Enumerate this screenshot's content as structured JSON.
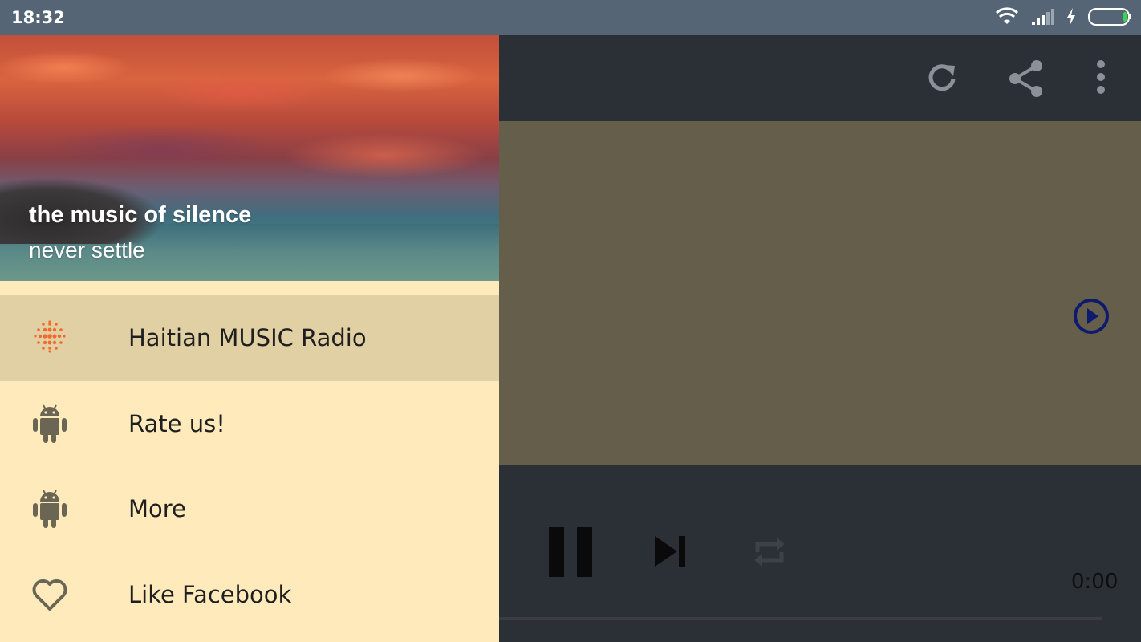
{
  "status_bar": {
    "time": "18:32",
    "icons": [
      "wifi-icon",
      "signal-icon",
      "charging-icon",
      "battery-icon"
    ]
  },
  "drawer": {
    "title": "the music of silence",
    "subtitle": "never settle",
    "items": [
      {
        "label": "Haitian MUSIC Radio",
        "icon": "radio-icon",
        "selected": true
      },
      {
        "label": "Rate us!",
        "icon": "android-icon"
      },
      {
        "label": "More",
        "icon": "android-icon"
      },
      {
        "label": "Like Facebook",
        "icon": "heart-icon"
      }
    ]
  },
  "toolbar": {
    "actions": [
      "refresh-icon",
      "share-icon",
      "more-vert-icon"
    ]
  },
  "player": {
    "time": "0:00",
    "controls": [
      "pause-icon",
      "skip-next-icon",
      "repeat-icon"
    ]
  },
  "colors": {
    "status_bar": "#566576",
    "drawer_bg": "#feeabb",
    "selected_item": "#e0d0a3",
    "toolbar": "#2b2f36",
    "content": "#655e4b",
    "play_accent": "#0d1a6e",
    "radio_icon": "#f26a2d"
  }
}
